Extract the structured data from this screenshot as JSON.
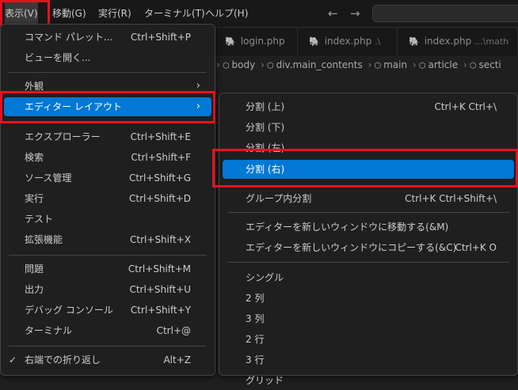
{
  "menubar": {
    "items": [
      "表示(V)",
      "移動(G)",
      "実行(R)",
      "ターミナル(T)",
      "ヘルプ(H)"
    ]
  },
  "nav": {
    "back": "←",
    "forward": "→"
  },
  "tabs": [
    {
      "name": "login.php",
      "hint": ""
    },
    {
      "name": "index.php",
      "hint": ".\\"
    },
    {
      "name": "index.php",
      "hint": "...\\math"
    }
  ],
  "breadcrumb": [
    "body",
    "div.main_contents",
    "main",
    "article",
    "secti"
  ],
  "view_menu": {
    "items": [
      {
        "label": "コマンド パレット...",
        "shortcut": "Ctrl+Shift+P"
      },
      {
        "label": "ビューを開く...",
        "shortcut": ""
      },
      {
        "label": "外観",
        "shortcut": ""
      },
      {
        "label": "エディター レイアウト",
        "shortcut": ""
      },
      {
        "label": "エクスプローラー",
        "shortcut": "Ctrl+Shift+E"
      },
      {
        "label": "検索",
        "shortcut": "Ctrl+Shift+F"
      },
      {
        "label": "ソース管理",
        "shortcut": "Ctrl+Shift+G"
      },
      {
        "label": "実行",
        "shortcut": "Ctrl+Shift+D"
      },
      {
        "label": "テスト",
        "shortcut": ""
      },
      {
        "label": "拡張機能",
        "shortcut": "Ctrl+Shift+X"
      },
      {
        "label": "問題",
        "shortcut": "Ctrl+Shift+M"
      },
      {
        "label": "出力",
        "shortcut": "Ctrl+Shift+U"
      },
      {
        "label": "デバッグ コンソール",
        "shortcut": "Ctrl+Shift+Y"
      },
      {
        "label": "ターミナル",
        "shortcut": "Ctrl+@"
      },
      {
        "label": "右端での折り返し",
        "shortcut": "Alt+Z",
        "checked": true
      }
    ]
  },
  "layout_submenu": {
    "items": [
      {
        "label": "分割 (上)",
        "shortcut": "Ctrl+K Ctrl+\\"
      },
      {
        "label": "分割 (下)",
        "shortcut": ""
      },
      {
        "label": "分割 (左)",
        "shortcut": ""
      },
      {
        "label": "分割 (右)",
        "shortcut": ""
      },
      {
        "label": "グループ内分割",
        "shortcut": "Ctrl+K Ctrl+Shift+\\"
      },
      {
        "label": "エディターを新しいウィンドウに移動する(&M)",
        "shortcut": ""
      },
      {
        "label": "エディターを新しいウィンドウにコピーする(&C)",
        "shortcut": "Ctrl+K O"
      },
      {
        "label": "シングル",
        "shortcut": ""
      },
      {
        "label": "2 列",
        "shortcut": ""
      },
      {
        "label": "3 列",
        "shortcut": ""
      },
      {
        "label": "2 行",
        "shortcut": ""
      },
      {
        "label": "3 行",
        "shortcut": ""
      },
      {
        "label": "グリッド",
        "shortcut": ""
      }
    ]
  },
  "colors": {
    "highlight": "#0078d4",
    "annotation": "#e8101e",
    "menu_bg": "#1f1f1f"
  },
  "icons": {
    "submenu_arrow": "chevron-right-icon",
    "check": "check-icon",
    "php": "php-elephant-icon",
    "symbol": "symbol-cube-icon"
  }
}
